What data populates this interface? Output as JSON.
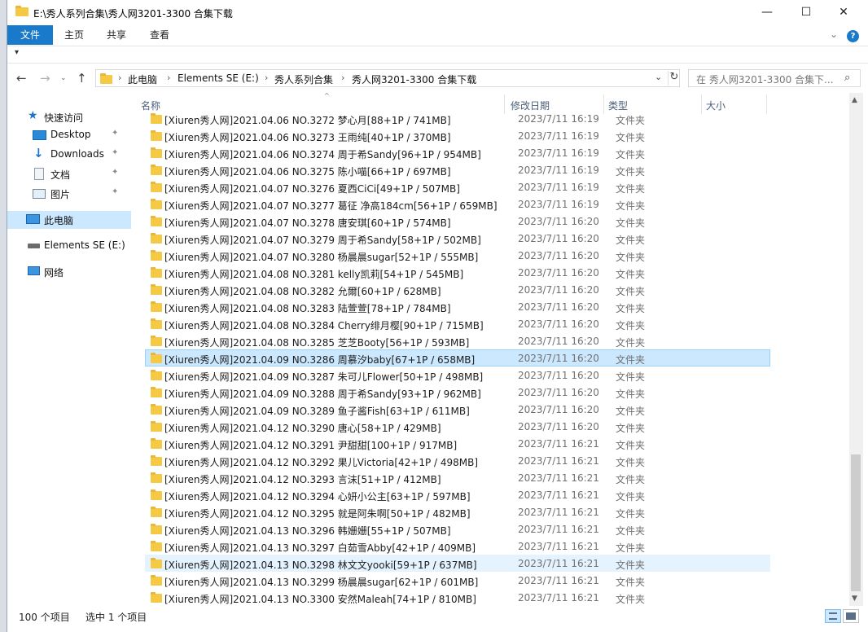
{
  "window": {
    "title": "E:\\秀人系列合集\\秀人网3201-3300 合集下载",
    "minimize_glyph": "—",
    "maximize_glyph": "☐",
    "close_glyph": "✕"
  },
  "ribbon": {
    "tabs": [
      "文件",
      "主页",
      "共享",
      "查看"
    ],
    "expand_glyph": "⌄",
    "help_glyph": "?"
  },
  "quick_access": {
    "dropdown_glyph": "▾"
  },
  "nav": {
    "back_glyph": "←",
    "forward_glyph": "→",
    "recent_glyph": "⌄",
    "up_glyph": "↑"
  },
  "address": {
    "crumbs": [
      "此电脑",
      "Elements SE (E:)",
      "秀人系列合集",
      "秀人网3201-3300 合集下载"
    ],
    "separator": "›",
    "dropdown_glyph": "⌄",
    "refresh_glyph": "↻"
  },
  "search": {
    "placeholder": "在 秀人网3201-3300 合集下...",
    "icon_glyph": "⌕"
  },
  "navpane": {
    "quick_access": "快速访问",
    "desktop": "Desktop",
    "downloads": "Downloads",
    "documents": "文档",
    "pictures": "图片",
    "this_pc": "此电脑",
    "drive": "Elements SE (E:)",
    "network": "网络",
    "pin_glyph": "📌"
  },
  "columns": {
    "name": "名称",
    "date": "修改日期",
    "type": "类型",
    "size": "大小",
    "sort_glyph": "^"
  },
  "files": [
    {
      "name": "[Xiuren秀人网]2021.04.06 NO.3272 梦心月[88+1P / 741MB]",
      "date": "2023/7/11 16:19",
      "type": "文件夹"
    },
    {
      "name": "[Xiuren秀人网]2021.04.06 NO.3273 王雨纯[40+1P / 370MB]",
      "date": "2023/7/11 16:19",
      "type": "文件夹"
    },
    {
      "name": "[Xiuren秀人网]2021.04.06 NO.3274 周于希Sandy[96+1P / 954MB]",
      "date": "2023/7/11 16:19",
      "type": "文件夹"
    },
    {
      "name": "[Xiuren秀人网]2021.04.06 NO.3275 陈小喵[66+1P / 697MB]",
      "date": "2023/7/11 16:19",
      "type": "文件夹"
    },
    {
      "name": "[Xiuren秀人网]2021.04.07 NO.3276 夏西CiCi[49+1P / 507MB]",
      "date": "2023/7/11 16:19",
      "type": "文件夹"
    },
    {
      "name": "[Xiuren秀人网]2021.04.07 NO.3277 葛征 净高184cm[56+1P / 659MB]",
      "date": "2023/7/11 16:19",
      "type": "文件夹"
    },
    {
      "name": "[Xiuren秀人网]2021.04.07 NO.3278 唐安琪[60+1P / 574MB]",
      "date": "2023/7/11 16:20",
      "type": "文件夹"
    },
    {
      "name": "[Xiuren秀人网]2021.04.07 NO.3279 周于希Sandy[58+1P / 502MB]",
      "date": "2023/7/11 16:20",
      "type": "文件夹"
    },
    {
      "name": "[Xiuren秀人网]2021.04.07 NO.3280 杨晨晨sugar[52+1P / 555MB]",
      "date": "2023/7/11 16:20",
      "type": "文件夹"
    },
    {
      "name": "[Xiuren秀人网]2021.04.08 NO.3281 kelly凯莉[54+1P / 545MB]",
      "date": "2023/7/11 16:20",
      "type": "文件夹"
    },
    {
      "name": "[Xiuren秀人网]2021.04.08 NO.3282 允爾[60+1P / 628MB]",
      "date": "2023/7/11 16:20",
      "type": "文件夹"
    },
    {
      "name": "[Xiuren秀人网]2021.04.08 NO.3283 陆萱萱[78+1P / 784MB]",
      "date": "2023/7/11 16:20",
      "type": "文件夹"
    },
    {
      "name": "[Xiuren秀人网]2021.04.08 NO.3284 Cherry绯月樱[90+1P / 715MB]",
      "date": "2023/7/11 16:20",
      "type": "文件夹"
    },
    {
      "name": "[Xiuren秀人网]2021.04.08 NO.3285 芝芝Booty[56+1P / 593MB]",
      "date": "2023/7/11 16:20",
      "type": "文件夹"
    },
    {
      "name": "[Xiuren秀人网]2021.04.09 NO.3286 周慕汐baby[67+1P / 658MB]",
      "date": "2023/7/11 16:20",
      "type": "文件夹"
    },
    {
      "name": "[Xiuren秀人网]2021.04.09 NO.3287 朱可儿Flower[50+1P / 498MB]",
      "date": "2023/7/11 16:20",
      "type": "文件夹"
    },
    {
      "name": "[Xiuren秀人网]2021.04.09 NO.3288 周于希Sandy[93+1P / 962MB]",
      "date": "2023/7/11 16:20",
      "type": "文件夹"
    },
    {
      "name": "[Xiuren秀人网]2021.04.09 NO.3289 鱼子酱Fish[63+1P / 611MB]",
      "date": "2023/7/11 16:20",
      "type": "文件夹"
    },
    {
      "name": "[Xiuren秀人网]2021.04.12 NO.3290 唐心[58+1P / 429MB]",
      "date": "2023/7/11 16:20",
      "type": "文件夹"
    },
    {
      "name": "[Xiuren秀人网]2021.04.12 NO.3291 尹甜甜[100+1P / 917MB]",
      "date": "2023/7/11 16:21",
      "type": "文件夹"
    },
    {
      "name": "[Xiuren秀人网]2021.04.12 NO.3292 果儿Victoria[42+1P / 498MB]",
      "date": "2023/7/11 16:21",
      "type": "文件夹"
    },
    {
      "name": "[Xiuren秀人网]2021.04.12 NO.3293 言沫[51+1P / 412MB]",
      "date": "2023/7/11 16:21",
      "type": "文件夹"
    },
    {
      "name": "[Xiuren秀人网]2021.04.12 NO.3294 心妍小公主[63+1P / 597MB]",
      "date": "2023/7/11 16:21",
      "type": "文件夹"
    },
    {
      "name": "[Xiuren秀人网]2021.04.12 NO.3295 就是阿朱啊[50+1P / 482MB]",
      "date": "2023/7/11 16:21",
      "type": "文件夹"
    },
    {
      "name": "[Xiuren秀人网]2021.04.13 NO.3296 韩姗姗[55+1P / 507MB]",
      "date": "2023/7/11 16:21",
      "type": "文件夹"
    },
    {
      "name": "[Xiuren秀人网]2021.04.13 NO.3297 白茹雪Abby[42+1P / 409MB]",
      "date": "2023/7/11 16:21",
      "type": "文件夹"
    },
    {
      "name": "[Xiuren秀人网]2021.04.13 NO.3298 林文文yooki[59+1P / 637MB]",
      "date": "2023/7/11 16:21",
      "type": "文件夹"
    },
    {
      "name": "[Xiuren秀人网]2021.04.13 NO.3299 杨晨晨sugar[62+1P / 601MB]",
      "date": "2023/7/11 16:21",
      "type": "文件夹"
    },
    {
      "name": "[Xiuren秀人网]2021.04.13 NO.3300 安然Maleah[74+1P / 810MB]",
      "date": "2023/7/11 16:21",
      "type": "文件夹"
    }
  ],
  "selected_index": 14,
  "hover_index": 26,
  "scrollbar": {
    "up_glyph": "▲",
    "down_glyph": "▼"
  },
  "status": {
    "item_count": "100 个项目",
    "selection": "选中 1 个项目"
  }
}
